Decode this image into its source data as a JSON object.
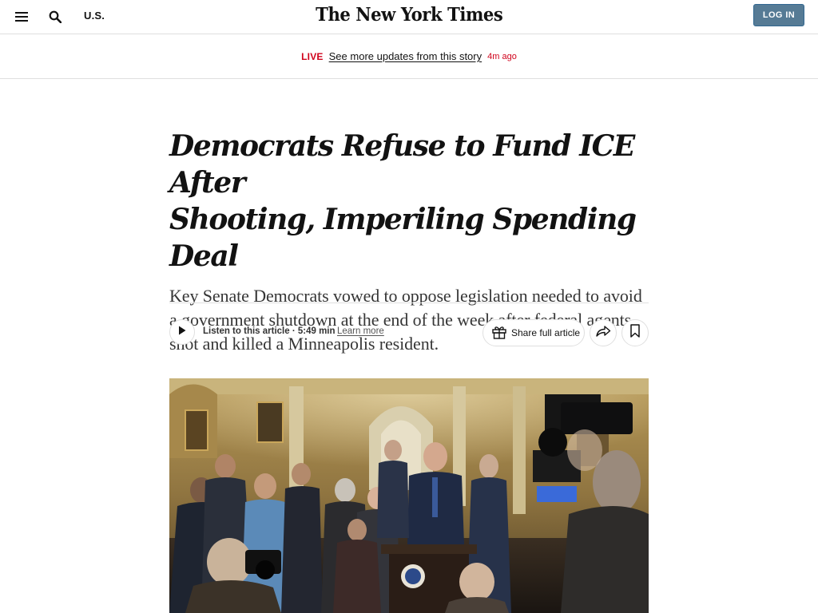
{
  "header": {
    "section_label": "U.S.",
    "logo_text": "The New York Times",
    "login_label": "LOG IN",
    "login_color": "#567b95"
  },
  "live_bar": {
    "tag": "LIVE",
    "link_text": "See more updates from this story",
    "time_ago": "4m ago",
    "accent_color": "#d0021b"
  },
  "article": {
    "headline_line1": "Democrats Refuse to Fund ICE After",
    "headline_line2": "Shooting, Imperiling Spending Deal",
    "summary": "Key Senate Democrats vowed to oppose legislation needed to avoid a government shutdown at the end of the week after federal agents shot and killed a Minneapolis resident."
  },
  "toolbar": {
    "listen_label": "Listen to this article",
    "listen_separator": " · ",
    "listen_duration": "5:49 min",
    "learn_more": "Learn more",
    "share_full_label": "Share full article"
  },
  "icons": {
    "menu": "hamburger-menu-icon",
    "search": "search-icon",
    "play": "play-icon",
    "gift": "gift-icon",
    "share": "share-arrow-icon",
    "bookmark": "bookmark-icon",
    "seal": "senate-seal-icon"
  }
}
